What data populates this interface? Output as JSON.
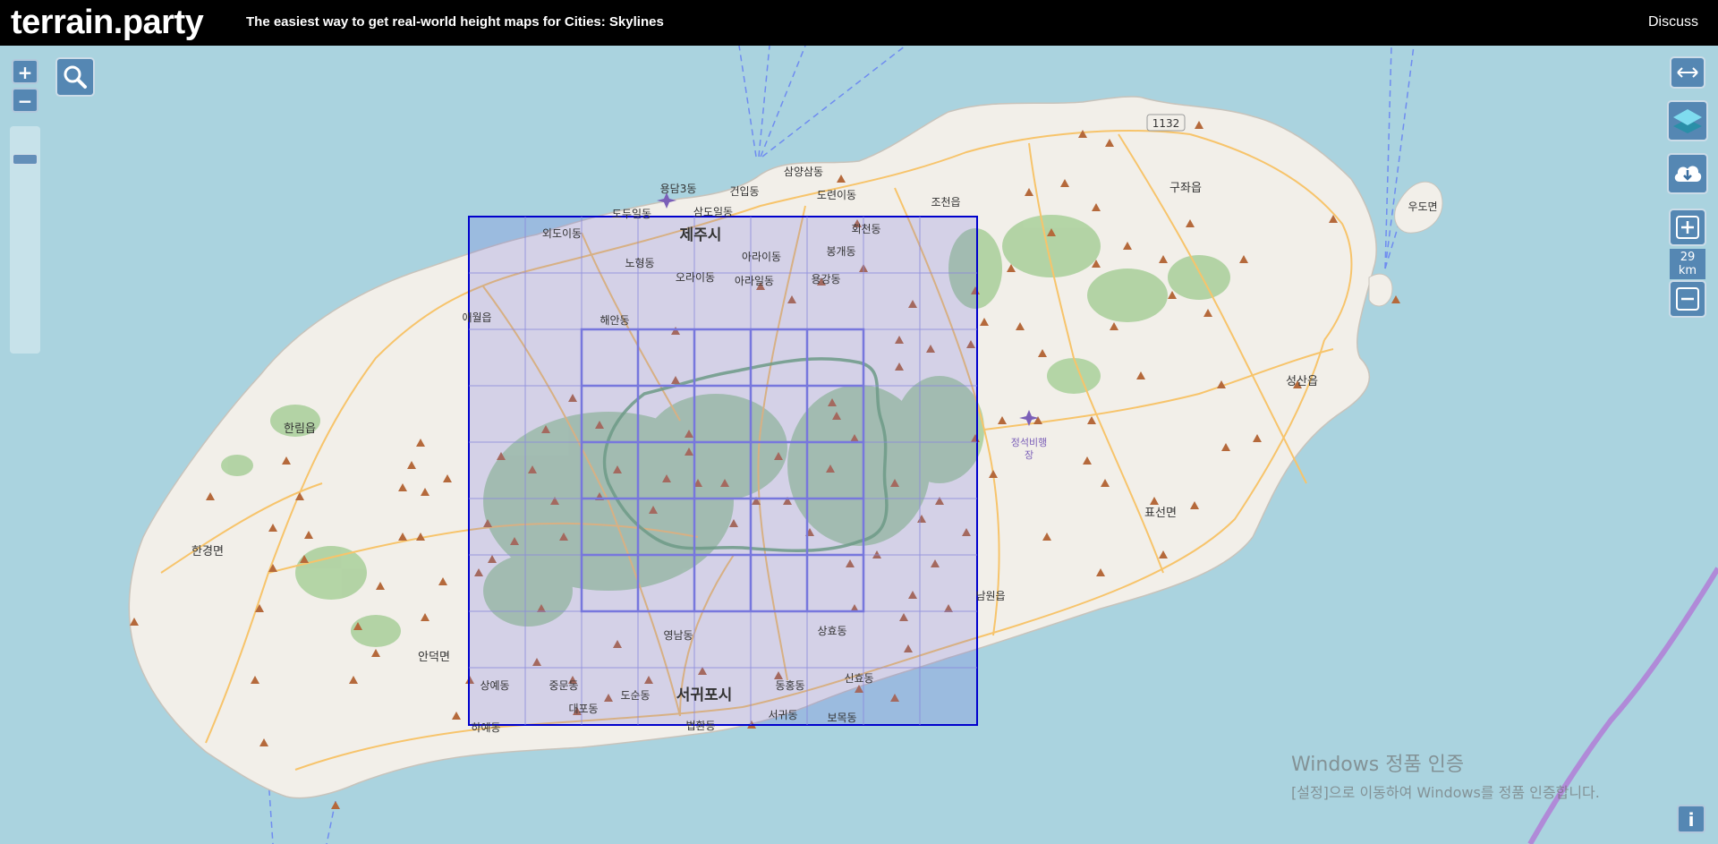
{
  "header": {
    "site_title": "terrain.party",
    "tagline": "The easiest way to get real-world height maps for Cities: Skylines",
    "discuss_label": "Discuss"
  },
  "controls": {
    "zoom_in_label": "+",
    "zoom_out_label": "−",
    "selection_size": "29",
    "selection_unit": "km",
    "info_label": "i",
    "icons": [
      "search-icon",
      "resize-arrows-icon",
      "layers-icon",
      "cloud-download-icon",
      "plus-box-icon",
      "minus-box-icon"
    ]
  },
  "map": {
    "road_label": "1132",
    "place_labels": [
      {
        "id": "jeju-si",
        "text": "제주시"
      },
      {
        "id": "seogwipo-si",
        "text": "서귀포시"
      },
      {
        "id": "yongdam3",
        "text": "용담3동"
      },
      {
        "id": "geonip",
        "text": "건입동"
      },
      {
        "id": "samyang3",
        "text": "삼양삼동"
      },
      {
        "id": "doryeon",
        "text": "도련이동"
      },
      {
        "id": "jocheon",
        "text": "조천읍"
      },
      {
        "id": "gujwa",
        "text": "구좌읍"
      },
      {
        "id": "udo",
        "text": "우도면"
      },
      {
        "id": "dodu",
        "text": "도두일동"
      },
      {
        "id": "samdo",
        "text": "삼도일동"
      },
      {
        "id": "odoi",
        "text": "외도이동"
      },
      {
        "id": "hoecheon",
        "text": "회천동"
      },
      {
        "id": "bonggae",
        "text": "봉개동"
      },
      {
        "id": "ara",
        "text": "아라이동"
      },
      {
        "id": "nohyeong",
        "text": "노형동"
      },
      {
        "id": "orai",
        "text": "오라이동"
      },
      {
        "id": "arail",
        "text": "아라일동"
      },
      {
        "id": "yonggang",
        "text": "용강동"
      },
      {
        "id": "haean",
        "text": "해안동"
      },
      {
        "id": "aewol",
        "text": "애월읍"
      },
      {
        "id": "hallim",
        "text": "한림읍"
      },
      {
        "id": "hangyeong",
        "text": "한경면"
      },
      {
        "id": "seongsan",
        "text": "성산읍"
      },
      {
        "id": "pyoseon",
        "text": "표선면"
      },
      {
        "id": "namwon",
        "text": "남원읍"
      },
      {
        "id": "jeongseok1",
        "text": "정석비행"
      },
      {
        "id": "jeongseok2",
        "text": "장"
      },
      {
        "id": "yeongnam",
        "text": "영남동"
      },
      {
        "id": "sanghyo",
        "text": "상효동"
      },
      {
        "id": "andeok",
        "text": "안덕면"
      },
      {
        "id": "sangye",
        "text": "상예동"
      },
      {
        "id": "jungmun",
        "text": "중문동"
      },
      {
        "id": "daepo",
        "text": "대포동"
      },
      {
        "id": "dosun",
        "text": "도순동"
      },
      {
        "id": "donghong",
        "text": "동홍동"
      },
      {
        "id": "sinhyo",
        "text": "신효동"
      },
      {
        "id": "seogwi",
        "text": "서귀동"
      },
      {
        "id": "bomok",
        "text": "보목동"
      },
      {
        "id": "beophwan",
        "text": "법환동"
      },
      {
        "id": "hayedong",
        "text": "하예동"
      }
    ]
  },
  "watermark": {
    "line1": "Windows 정품 인증",
    "line2": "[설정]으로 이동하여 Windows를 정품 인증합니다."
  },
  "colors": {
    "sea": "#aad3df",
    "land": "#f2efe9",
    "forest": "#add19e",
    "road": "#f7c46b",
    "selection": "#0000cc",
    "grid": "#8888dd",
    "peak": "#b5693b"
  }
}
